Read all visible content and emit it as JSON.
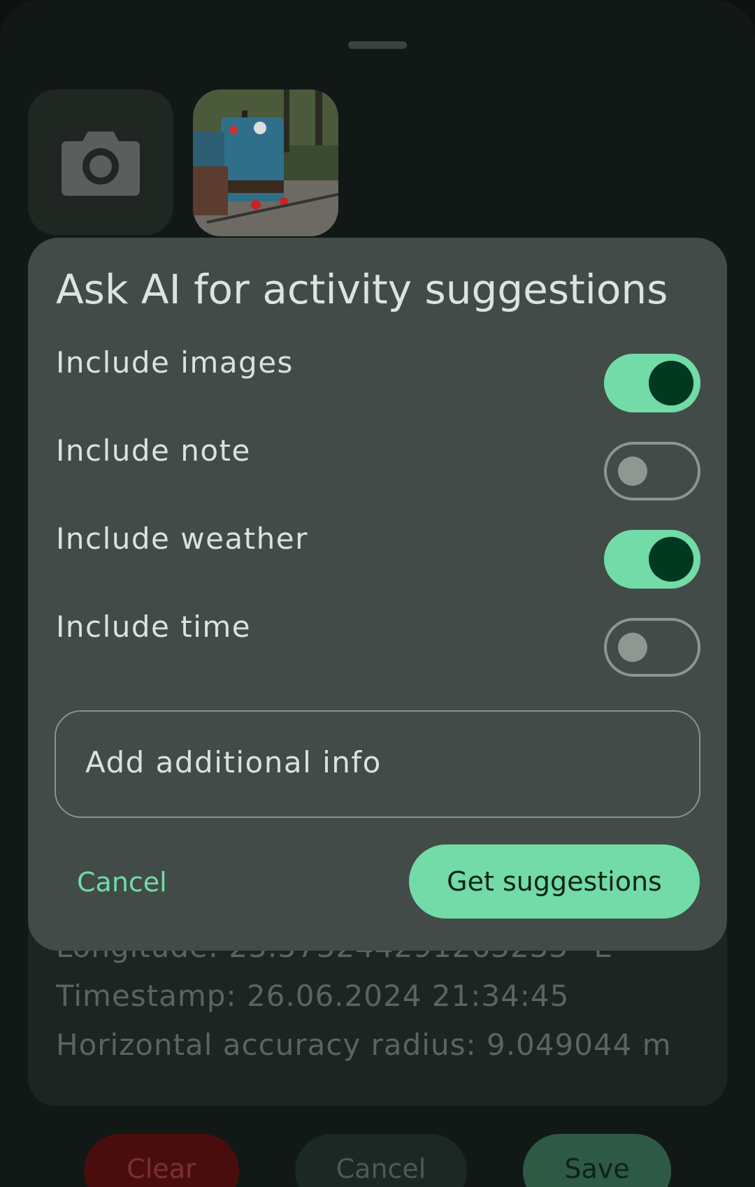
{
  "sheet": {
    "photo_alt": "Photo of a blue miniature train locomotive"
  },
  "location_info": {
    "longitude": "Longitude: 23.573244291263233° E",
    "timestamp": "Timestamp: 26.06.2024 21:34:45",
    "accuracy": "Horizontal accuracy radius: 9.049044 m"
  },
  "bottom_buttons": {
    "clear": "Clear",
    "cancel": "Cancel",
    "save": "Save"
  },
  "dialog": {
    "title": "Ask AI for activity suggestions",
    "options": [
      {
        "label": "Include images",
        "enabled": true
      },
      {
        "label": "Include note",
        "enabled": false
      },
      {
        "label": "Include weather",
        "enabled": true
      },
      {
        "label": "Include time",
        "enabled": false
      }
    ],
    "additional_info_placeholder": "Add additional info",
    "cancel_label": "Cancel",
    "confirm_label": "Get suggestions"
  },
  "colors": {
    "accent": "#72dba7",
    "dialog_bg": "#424b47",
    "switch_thumb_on": "#00391f",
    "clear_button": "#4a0d0d"
  }
}
